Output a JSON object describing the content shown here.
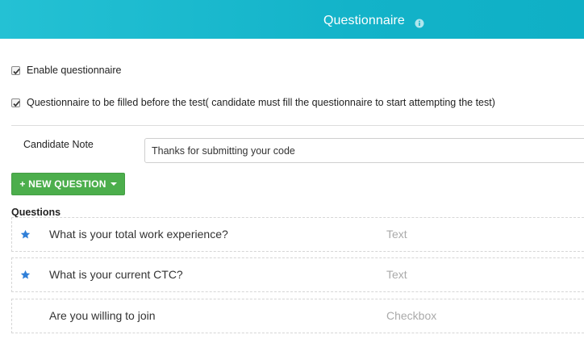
{
  "header": {
    "title": "Questionnaire",
    "info_icon": "info-icon",
    "gradient_start": "#24c1d4",
    "gradient_end": "#0fb0c6"
  },
  "options": {
    "enable_label": "Enable questionnaire",
    "enable_checked": true,
    "before_test_label": "Questionnaire to be filled before the test( candidate must fill the questionnaire to start attempting the test)",
    "before_test_checked": true
  },
  "candidate_note": {
    "label": "Candidate Note",
    "value": "Thanks for submitting your code"
  },
  "new_question_button": {
    "label": "+ NEW QUESTION",
    "color": "#4cae4c"
  },
  "questions": {
    "heading": "Questions",
    "items": [
      {
        "text": "What is your total work experience?",
        "type": "Text",
        "starred": true
      },
      {
        "text": "What is your current CTC?",
        "type": "Text",
        "starred": true
      },
      {
        "text": "Are you willing to join",
        "type": "Checkbox",
        "starred": false
      }
    ],
    "star_color": "#2f7fd8"
  }
}
